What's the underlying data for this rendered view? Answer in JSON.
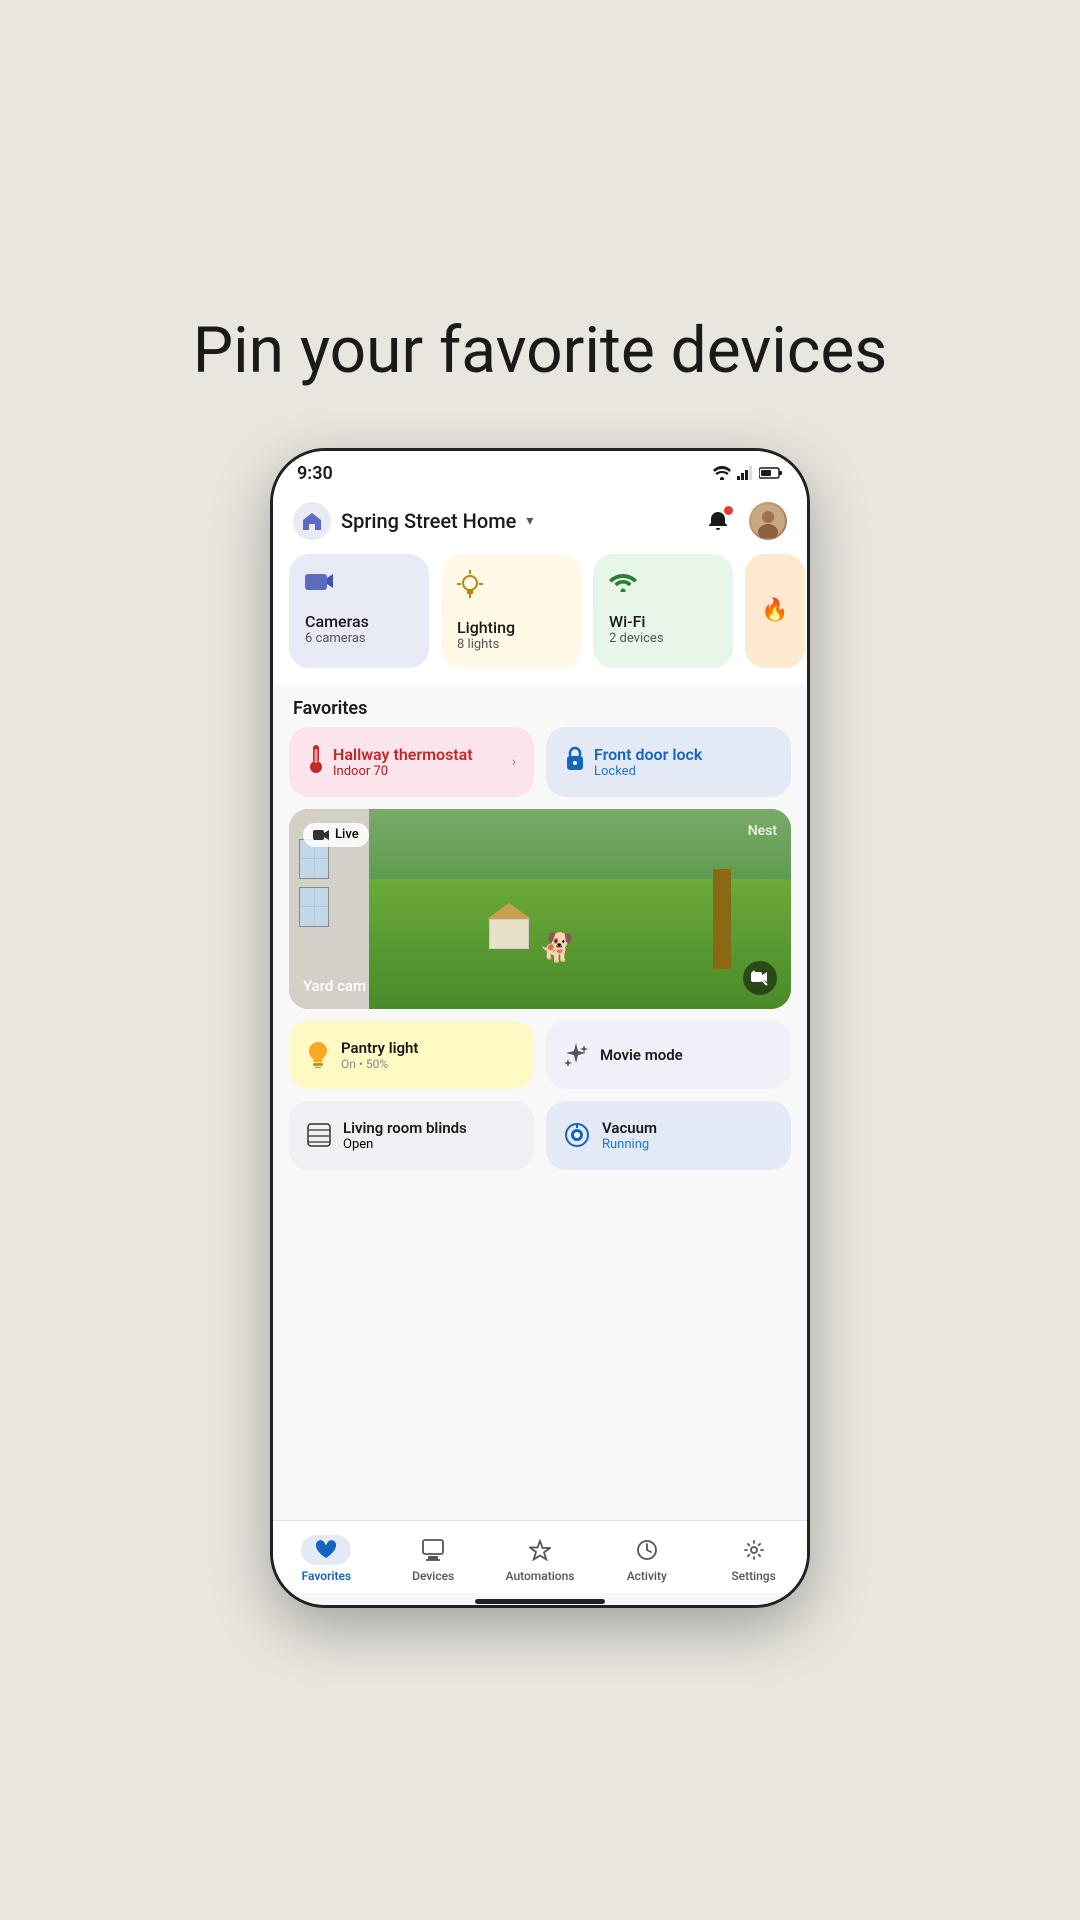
{
  "page": {
    "title": "Pin your favorite devices",
    "background": "#e8e6de"
  },
  "status_bar": {
    "time": "9:30",
    "wifi": "▼",
    "signal": "▲",
    "battery": "🔋"
  },
  "header": {
    "home_name": "Spring Street Home",
    "chevron": "∨",
    "notif_label": "notifications",
    "avatar_label": "user avatar"
  },
  "categories": [
    {
      "id": "cameras",
      "icon": "📹",
      "name": "Cameras",
      "sub": "6 cameras",
      "color": "#e8eaf6"
    },
    {
      "id": "lighting",
      "icon": "💡",
      "name": "Lighting",
      "sub": "8 lights",
      "color": "#fff9e6"
    },
    {
      "id": "wifi",
      "icon": "📶",
      "name": "Wi-Fi",
      "sub": "2 devices",
      "color": "#e8f5e9"
    }
  ],
  "favorites": {
    "section_label": "Favorites",
    "items": [
      {
        "id": "thermostat",
        "icon": "🌡️",
        "title": "Hallway thermostat",
        "sub": "Indoor 70",
        "type": "thermostat",
        "has_chevron": true
      },
      {
        "id": "lock",
        "icon": "🔒",
        "title": "Front door lock",
        "sub": "Locked",
        "type": "lock",
        "has_chevron": false
      }
    ]
  },
  "camera_feed": {
    "live_label": "Live",
    "brand": "Nest",
    "name": "Yard cam",
    "no_record_icon": "⊘"
  },
  "quick_actions": [
    {
      "id": "pantry",
      "icon": "💡",
      "title": "Pantry light",
      "sub": "On • 50%",
      "type": "pantry"
    },
    {
      "id": "movie",
      "icon": "✦",
      "title": "Movie mode",
      "sub": "",
      "type": "movie"
    }
  ],
  "second_actions": [
    {
      "id": "blinds",
      "icon": "▦",
      "title": "Living room blinds",
      "sub": "Open",
      "type": "blinds"
    },
    {
      "id": "vacuum",
      "icon": "🤖",
      "title": "Vacuum",
      "sub": "Running",
      "type": "vacuum"
    }
  ],
  "bottom_nav": {
    "items": [
      {
        "id": "favorites",
        "icon": "♥",
        "label": "Favorites",
        "active": true
      },
      {
        "id": "devices",
        "icon": "⊞",
        "label": "Devices",
        "active": false
      },
      {
        "id": "automations",
        "icon": "✦",
        "label": "Automations",
        "active": false
      },
      {
        "id": "activity",
        "icon": "🕐",
        "label": "Activity",
        "active": false
      },
      {
        "id": "settings",
        "icon": "⚙",
        "label": "Settings",
        "active": false
      }
    ]
  }
}
